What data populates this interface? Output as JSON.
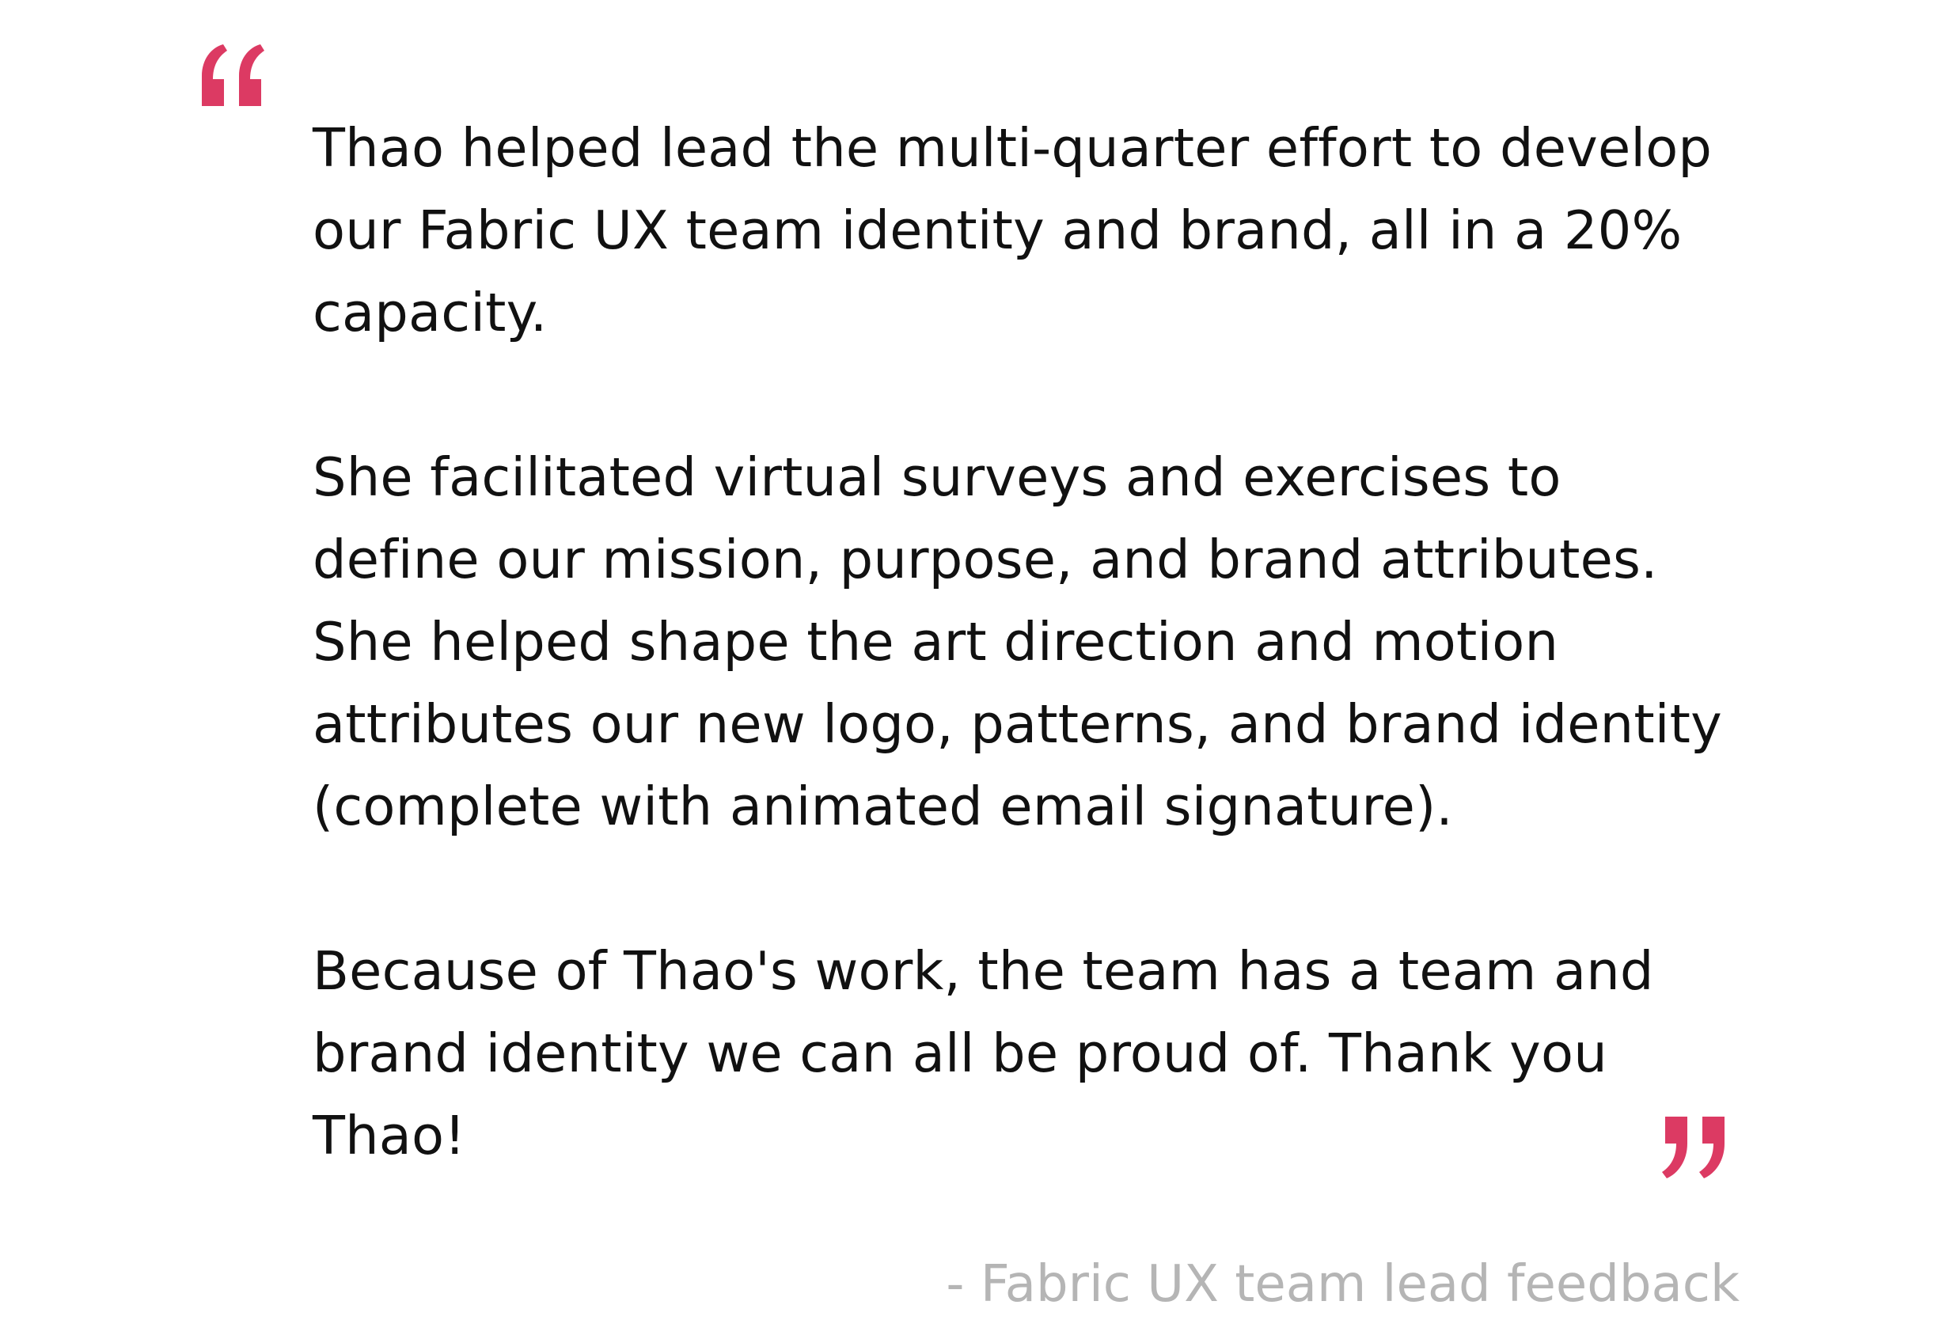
{
  "testimonial": {
    "paragraphs": [
      "Thao helped lead the multi-quarter effort to develop our Fabric UX team identity and brand, all in a 20% capacity.",
      "She facilitated virtual surveys and exercises to define our mission, purpose, and brand attributes. She helped shape the art direction and motion attributes our new logo, patterns, and brand identity (complete with animated email signature).",
      "Because of Thao's work, the team has a team and brand identity we can all be proud of. Thank you Thao!"
    ],
    "attribution": "- Fabric UX team lead feedback"
  },
  "icons": {
    "open_quote": "open-quote-icon",
    "close_quote": "close-quote-icon"
  },
  "colors": {
    "accent": "#dc3a63",
    "text": "#111111",
    "muted": "#b5b5b5",
    "background": "#ffffff"
  }
}
